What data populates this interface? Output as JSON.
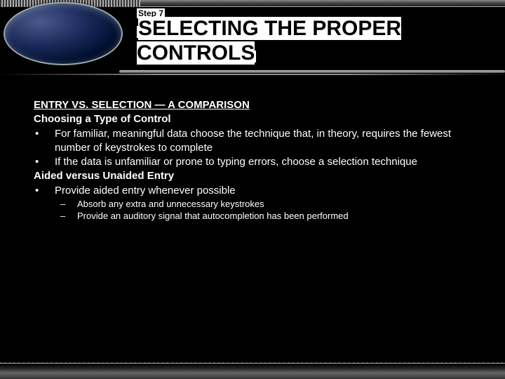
{
  "step_label": "Step 7",
  "title": "SELECTING THE PROPER CONTROLS",
  "heading": "ENTRY VS. SELECTION — A COMPARISON",
  "section1": {
    "subheading": "Choosing a Type of Control",
    "bullets": [
      "For familiar, meaningful data choose the technique that, in theory, requires the fewest number of keystrokes to complete",
      "If the data is unfamiliar or prone to typing errors, choose a selection technique"
    ]
  },
  "section2": {
    "subheading": "Aided versus Unaided Entry",
    "bullets": [
      "Provide aided entry whenever possible"
    ],
    "subbullets": [
      "Absorb any extra and unnecessary keystrokes",
      "Provide an auditory signal that autocompletion has been performed"
    ]
  },
  "bullet_char": "•",
  "dash_char": "–"
}
